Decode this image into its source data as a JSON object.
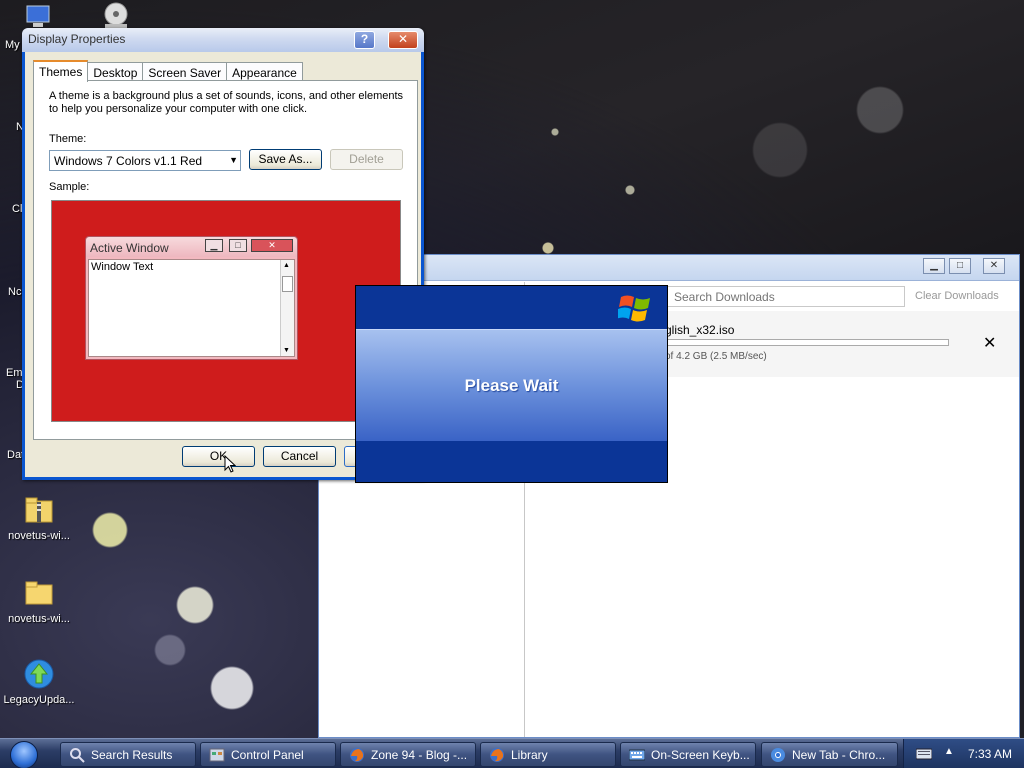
{
  "desktop": {
    "icons": [
      {
        "label": "novetus-wi...",
        "icon": "zip-folder-icon"
      },
      {
        "label": "novetus-wi...",
        "icon": "folder-icon"
      },
      {
        "label": "LegacyUpda...",
        "icon": "update-globe-icon"
      }
    ],
    "partial_labels": [
      "My",
      "N",
      "Cl",
      "Nc",
      "Em",
      "D",
      "Dat"
    ]
  },
  "display_properties": {
    "title": "Display Properties",
    "help_glyph": "?",
    "close_glyph": "✕",
    "tabs": [
      "Themes",
      "Desktop",
      "Screen Saver",
      "Appearance"
    ],
    "description": "A theme is a background plus a set of sounds, icons, and other elements to help you personalize your computer with one click.",
    "theme_label": "Theme:",
    "theme_value": "Windows 7 Colors v1.1 Red",
    "save_as": "Save As...",
    "delete": "Delete",
    "sample_label": "Sample:",
    "sample": {
      "window_title": "Active Window",
      "window_text": "Window Text",
      "min_glyph": "▁",
      "max_glyph": "□",
      "close_glyph": "✕"
    },
    "ok": "OK",
    "cancel": "Cancel"
  },
  "downloads": {
    "search_placeholder": "Search Downloads",
    "clear": "Clear Downloads",
    "item_name": "glish_x32.iso",
    "item_status": "of 4.2 GB (2.5 MB/sec)",
    "progress": 0.0,
    "remove_glyph": "✕"
  },
  "splash": {
    "message": "Please Wait"
  },
  "taskbar": {
    "items": [
      {
        "label": "Search Results",
        "icon": "search-icon"
      },
      {
        "label": "Control Panel",
        "icon": "control-panel-icon"
      },
      {
        "label": "Zone 94 - Blog -...",
        "icon": "firefox-icon"
      },
      {
        "label": "Library",
        "icon": "firefox-icon"
      },
      {
        "label": "On-Screen Keyb...",
        "icon": "keyboard-icon"
      },
      {
        "label": "New Tab - Chro...",
        "icon": "chrome-icon"
      }
    ],
    "time": "7:33 AM"
  }
}
